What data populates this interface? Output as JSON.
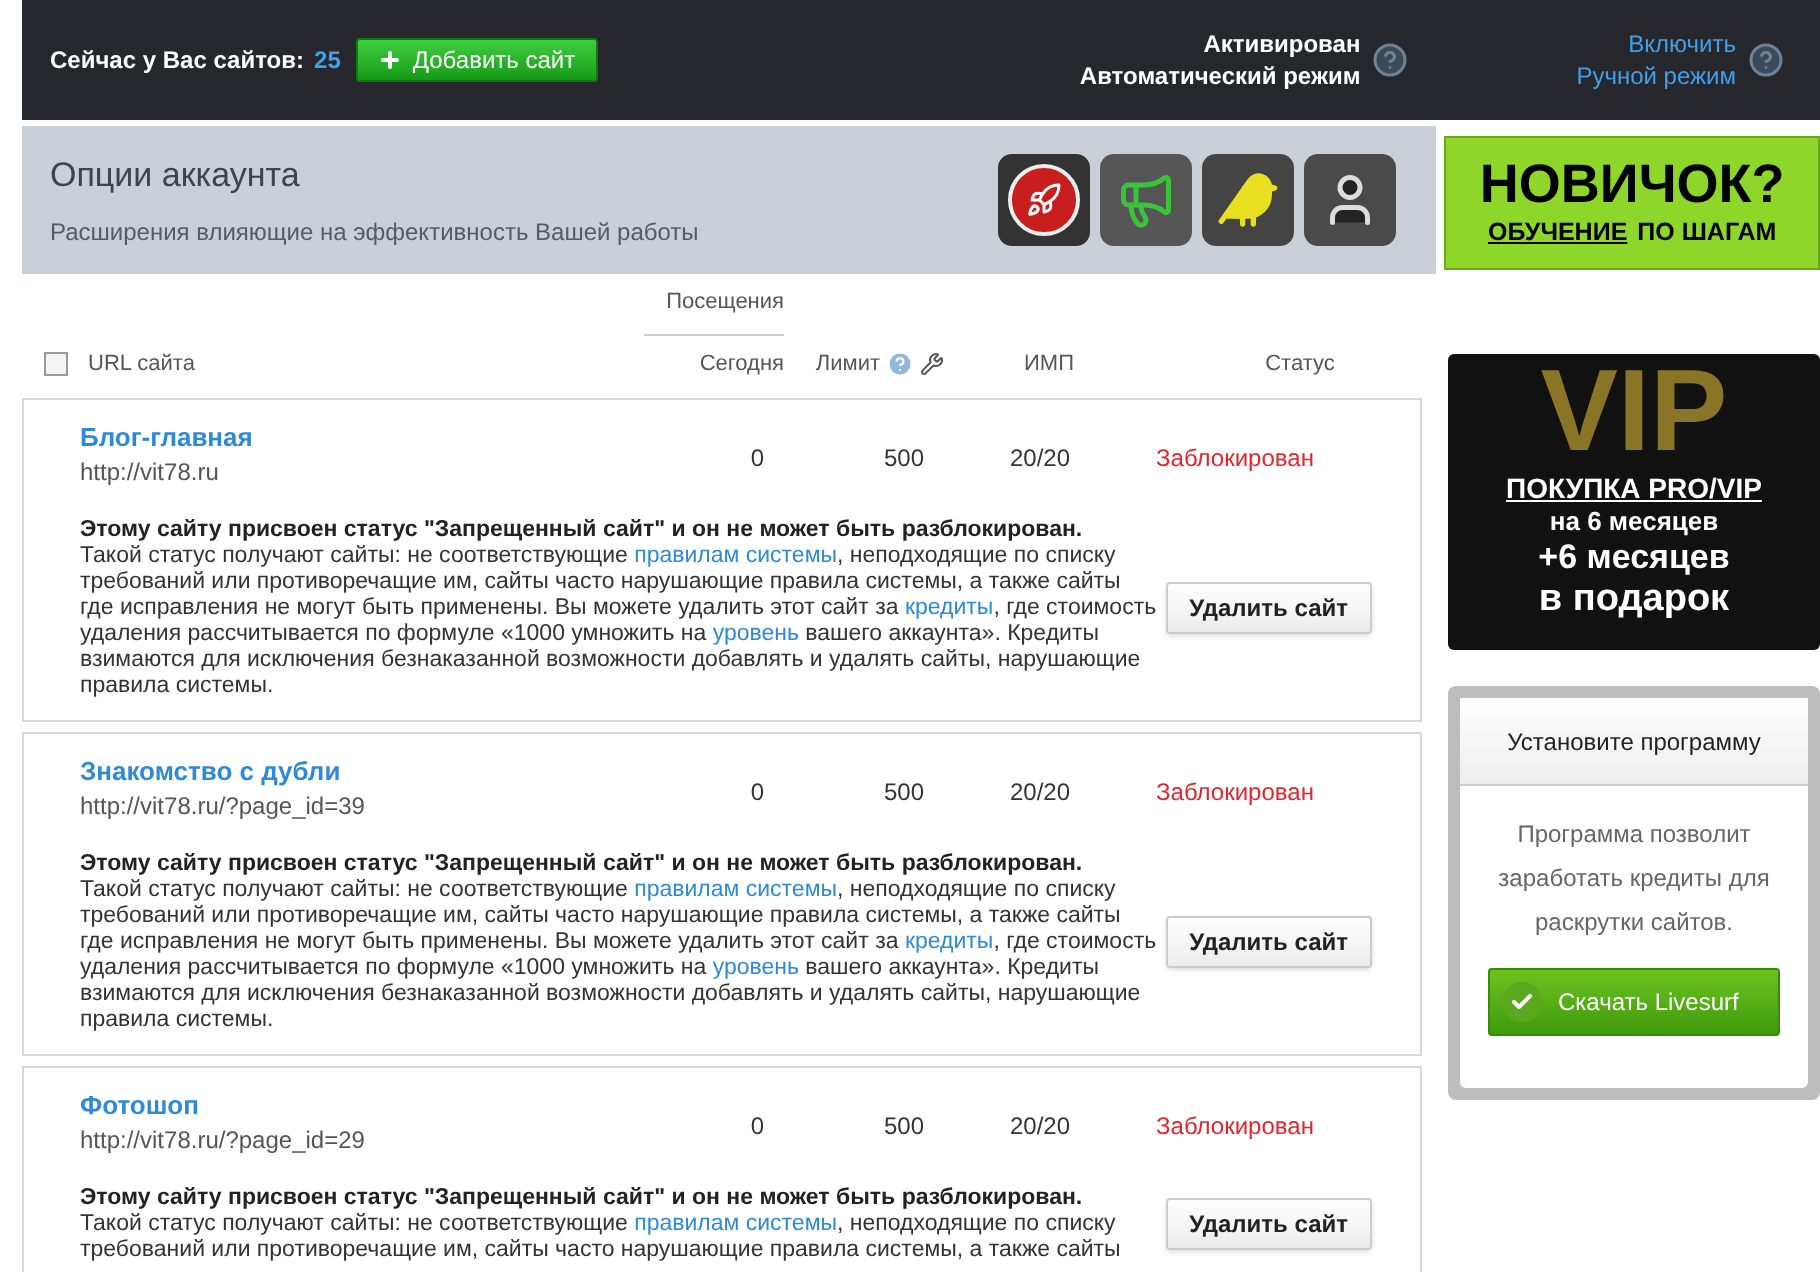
{
  "header": {
    "sites_label": "Сейчас у Вас сайтов:",
    "sites_count": "25",
    "add_button": "Добавить сайт",
    "modes": [
      {
        "kind": "active",
        "status": "Активирован",
        "mode": "Автоматический режим"
      },
      {
        "kind": "link",
        "status": "Включить",
        "mode": "Ручной режим"
      }
    ]
  },
  "account_options": {
    "title": "Опции аккаунта",
    "subtitle": "Расширения влияющие на эффективность Вашей работы"
  },
  "beginner_banner": {
    "headline": "НОВИЧОК?",
    "underlined": "ОБУЧЕНИЕ",
    "rest": "ПО ШАГАМ"
  },
  "table": {
    "select_all_checked": false,
    "group_heading": "Посещения",
    "columns": [
      "URL сайта",
      "Сегодня",
      "Лимит",
      "ИМП",
      "Статус"
    ],
    "rows": [
      {
        "title": "Блог-главная",
        "url": "http://vit78.ru",
        "today": "0",
        "limit": "500",
        "imp": "20/20",
        "status": "Заблокирован",
        "notice": "Этому сайту присвоен статус \"Запрещенный сайт\" и он не может быть разблокирован.",
        "description": [
          {
            "kind": "text",
            "text": "Такой статус получают сайты: не соответствующие "
          },
          {
            "kind": "link",
            "text": "правилам системы"
          },
          {
            "kind": "text",
            "text": ", неподходящие по списку требований или противоречащие им, сайты часто нарушающие правила системы, а также сайты где исправления не могут быть применены. Вы можете удалить этот сайт за "
          },
          {
            "kind": "link",
            "text": "кредиты"
          },
          {
            "kind": "text",
            "text": ", где стоимость удаления рассчитывается по формуле «1000 умножить на "
          },
          {
            "kind": "link",
            "text": "уровень"
          },
          {
            "kind": "text",
            "text": " вашего аккаунта». Кредиты взимаются для исключения безнаказанной возможности добавлять и удалять сайты, нарушающие правила системы."
          }
        ],
        "button": "Удалить сайт"
      },
      {
        "title": "Знакомство с дубли",
        "url": "http://vit78.ru/?page_id=39",
        "today": "0",
        "limit": "500",
        "imp": "20/20",
        "status": "Заблокирован",
        "notice": "Этому сайту присвоен статус \"Запрещенный сайт\" и он не может быть разблокирован.",
        "description": [
          {
            "kind": "text",
            "text": "Такой статус получают сайты: не соответствующие "
          },
          {
            "kind": "link",
            "text": "правилам системы"
          },
          {
            "kind": "text",
            "text": ", неподходящие по списку требований или противоречащие им, сайты часто нарушающие правила системы, а также сайты где исправления не могут быть применены. Вы можете удалить этот сайт за "
          },
          {
            "kind": "link",
            "text": "кредиты"
          },
          {
            "kind": "text",
            "text": ", где стоимость удаления рассчитывается по формуле «1000 умножить на "
          },
          {
            "kind": "link",
            "text": "уровень"
          },
          {
            "kind": "text",
            "text": " вашего аккаунта». Кредиты взимаются для исключения безнаказанной возможности добавлять и удалять сайты, нарушающие правила системы."
          }
        ],
        "button": "Удалить сайт"
      },
      {
        "title": "Фотошоп",
        "url": "http://vit78.ru/?page_id=29",
        "today": "0",
        "limit": "500",
        "imp": "20/20",
        "status": "Заблокирован",
        "notice": "Этому сайту присвоен статус \"Запрещенный сайт\" и он не может быть разблокирован.",
        "description": [
          {
            "kind": "text",
            "text": "Такой статус получают сайты: не соответствующие "
          },
          {
            "kind": "link",
            "text": "правилам системы"
          },
          {
            "kind": "text",
            "text": ", неподходящие по списку требований или противоречащие им, сайты часто нарушающие правила системы, а также сайты"
          }
        ],
        "button": "Удалить сайт"
      }
    ]
  },
  "vip_banner": {
    "logo": "VIP",
    "line_1": "ПОКУПКА PRO/VIP",
    "line_2": "на 6 месяцев",
    "line_3": "+6 месяцев",
    "line_4": "в подарок"
  },
  "install_box": {
    "title": "Установите программу",
    "text": "Программа позволит заработать кредиты для раскрутки сайтов.",
    "button": "Скачать Livesurf"
  }
}
